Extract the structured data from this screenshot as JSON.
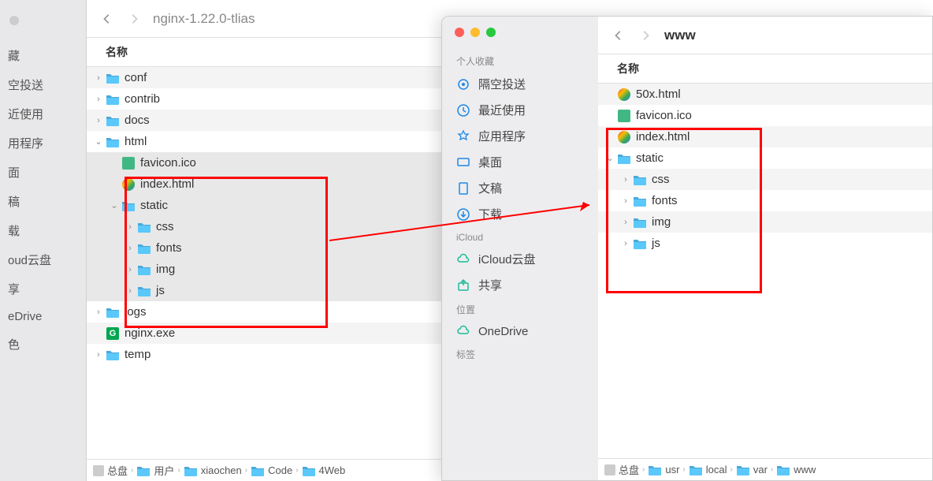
{
  "left": {
    "title": "nginx-1.22.0-tlias",
    "header": "名称",
    "sidebar": [
      "藏",
      "空投送",
      "近使用",
      "用程序",
      "面",
      "稿",
      "载",
      "oud云盘",
      "享",
      "eDrive",
      "色"
    ],
    "rows": [
      {
        "indent": 0,
        "disc": ">",
        "type": "folder",
        "label": "conf",
        "alt": true
      },
      {
        "indent": 0,
        "disc": ">",
        "type": "folder",
        "label": "contrib",
        "alt": false
      },
      {
        "indent": 0,
        "disc": ">",
        "type": "folder",
        "label": "docs",
        "alt": true
      },
      {
        "indent": 0,
        "disc": "v",
        "type": "folder",
        "label": "html",
        "alt": false
      },
      {
        "indent": 1,
        "disc": "",
        "type": "ico",
        "label": "favicon.ico",
        "alt": true,
        "sel": true
      },
      {
        "indent": 1,
        "disc": "",
        "type": "html",
        "label": "index.html",
        "alt": false,
        "sel": true
      },
      {
        "indent": 1,
        "disc": "v",
        "type": "folder",
        "label": "static",
        "alt": true,
        "sel": true
      },
      {
        "indent": 2,
        "disc": ">",
        "type": "folder",
        "label": "css",
        "alt": false,
        "sel": true
      },
      {
        "indent": 2,
        "disc": ">",
        "type": "folder",
        "label": "fonts",
        "alt": true,
        "sel": true
      },
      {
        "indent": 2,
        "disc": ">",
        "type": "folder",
        "label": "img",
        "alt": false,
        "sel": true
      },
      {
        "indent": 2,
        "disc": ">",
        "type": "folder",
        "label": "js",
        "alt": true,
        "sel": true
      },
      {
        "indent": 0,
        "disc": ">",
        "type": "folder",
        "label": "logs",
        "alt": false
      },
      {
        "indent": 0,
        "disc": "",
        "type": "exe",
        "label": "nginx.exe",
        "alt": true
      },
      {
        "indent": 0,
        "disc": ">",
        "type": "folder",
        "label": "temp",
        "alt": false
      }
    ],
    "path": [
      "总盘",
      "用户",
      "xiaochen",
      "Code",
      "4Web"
    ]
  },
  "right": {
    "title": "www",
    "header": "名称",
    "sections": {
      "fav": {
        "title": "个人收藏",
        "items": [
          {
            "icon": "airdrop",
            "label": "隔空投送"
          },
          {
            "icon": "recent",
            "label": "最近使用"
          },
          {
            "icon": "apps",
            "label": "应用程序"
          },
          {
            "icon": "desktop",
            "label": "桌面"
          },
          {
            "icon": "docs",
            "label": "文稿"
          },
          {
            "icon": "downloads",
            "label": "下载"
          }
        ]
      },
      "icloud": {
        "title": "iCloud",
        "items": [
          {
            "icon": "cloud",
            "label": "iCloud云盘"
          },
          {
            "icon": "share",
            "label": "共享"
          }
        ]
      },
      "loc": {
        "title": "位置",
        "items": [
          {
            "icon": "cloud",
            "label": "OneDrive"
          }
        ]
      },
      "tags": {
        "title": "标签"
      }
    },
    "rows": [
      {
        "indent": 0,
        "disc": "",
        "type": "html",
        "label": "50x.html",
        "alt": true
      },
      {
        "indent": 0,
        "disc": "",
        "type": "ico",
        "label": "favicon.ico",
        "alt": false
      },
      {
        "indent": 0,
        "disc": "",
        "type": "html",
        "label": "index.html",
        "alt": true
      },
      {
        "indent": 0,
        "disc": "v",
        "type": "folder",
        "label": "static",
        "alt": false
      },
      {
        "indent": 1,
        "disc": ">",
        "type": "folder",
        "label": "css",
        "alt": true
      },
      {
        "indent": 1,
        "disc": ">",
        "type": "folder",
        "label": "fonts",
        "alt": false
      },
      {
        "indent": 1,
        "disc": ">",
        "type": "folder",
        "label": "img",
        "alt": true
      },
      {
        "indent": 1,
        "disc": ">",
        "type": "folder",
        "label": "js",
        "alt": false
      }
    ],
    "path": [
      "总盘",
      "usr",
      "local",
      "var",
      "www"
    ]
  }
}
